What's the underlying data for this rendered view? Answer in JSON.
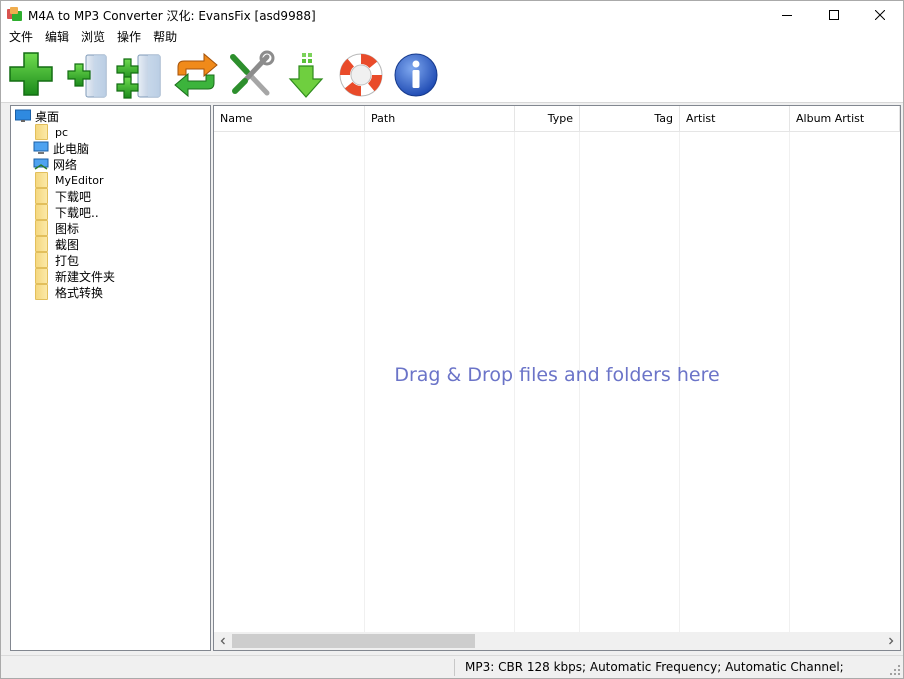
{
  "window": {
    "title": "M4A to MP3 Converter  汉化: EvansFix [asd9988]",
    "controls": {
      "minimize_icon": "minimize-icon",
      "maximize_icon": "maximize-icon",
      "close_icon": "close-icon"
    }
  },
  "menu": {
    "items": [
      {
        "label": "文件"
      },
      {
        "label": "编辑"
      },
      {
        "label": "浏览"
      },
      {
        "label": "操作"
      },
      {
        "label": "帮助"
      }
    ]
  },
  "toolbar": {
    "buttons": [
      {
        "name": "add-files",
        "icon": "green-plus-icon"
      },
      {
        "name": "add-file-list",
        "icon": "plus-file-icon"
      },
      {
        "name": "add-folder",
        "icon": "plus-folder-icon"
      },
      {
        "name": "convert",
        "icon": "convert-arrows-icon"
      },
      {
        "name": "settings",
        "icon": "tools-icon"
      },
      {
        "name": "download",
        "icon": "download-arrow-icon"
      },
      {
        "name": "help",
        "icon": "lifebuoy-icon"
      },
      {
        "name": "about",
        "icon": "info-icon"
      }
    ]
  },
  "tree": {
    "root": {
      "label": "桌面",
      "icon": "desktop-icon"
    },
    "items": [
      {
        "label": "pc",
        "icon": "folder-icon"
      },
      {
        "label": "此电脑",
        "icon": "computer-icon"
      },
      {
        "label": "网络",
        "icon": "network-icon"
      },
      {
        "label": "MyEditor",
        "icon": "folder-icon"
      },
      {
        "label": "下载吧",
        "icon": "folder-icon"
      },
      {
        "label": "下载吧..",
        "icon": "folder-icon"
      },
      {
        "label": "图标",
        "icon": "folder-icon"
      },
      {
        "label": "截图",
        "icon": "folder-icon"
      },
      {
        "label": "打包",
        "icon": "folder-icon"
      },
      {
        "label": "新建文件夹",
        "icon": "folder-icon"
      },
      {
        "label": "格式转换",
        "icon": "folder-icon"
      }
    ]
  },
  "file_list": {
    "columns": [
      {
        "label": "Name"
      },
      {
        "label": "Path"
      },
      {
        "label": "Type"
      },
      {
        "label": "Tag"
      },
      {
        "label": "Artist"
      },
      {
        "label": "Album Artist"
      }
    ],
    "empty_hint": "Drag & Drop files and folders here"
  },
  "status": {
    "text": "MP3:  CBR 128 kbps; Automatic Frequency; Automatic Channel;"
  },
  "colors": {
    "hint": "#6b74c8",
    "toolbar_green": "#2fae2f",
    "info_blue": "#2b5fc9"
  }
}
